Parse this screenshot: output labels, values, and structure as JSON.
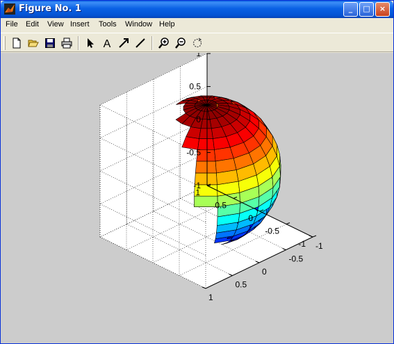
{
  "window": {
    "title": "Figure No. 1",
    "controls": {
      "minimize": "_",
      "maximize": "□",
      "close": "×"
    }
  },
  "menu": [
    "File",
    "Edit",
    "View",
    "Insert",
    "Tools",
    "Window",
    "Help"
  ],
  "toolbar": {
    "buttons": [
      {
        "icon": "new-file-icon"
      },
      {
        "icon": "open-folder-icon"
      },
      {
        "icon": "save-icon"
      },
      {
        "icon": "print-icon"
      },
      {
        "icon": "select-arrow-icon"
      },
      {
        "icon": "insert-text-icon",
        "glyph": "A"
      },
      {
        "icon": "insert-arrow-icon"
      },
      {
        "icon": "insert-line-icon"
      },
      {
        "icon": "zoom-in-icon"
      },
      {
        "icon": "zoom-out-icon"
      },
      {
        "icon": "rotate-3d-icon"
      }
    ]
  },
  "chart_data": {
    "type": "surface",
    "shape": "unit sphere",
    "colormap": "jet",
    "grid": true,
    "z_ticks": [
      "1",
      "0.5",
      "0",
      "-0.5",
      "-1"
    ],
    "y_ticks": [
      "1",
      "0.5",
      "0",
      "-0.5",
      "-1"
    ],
    "x_ticks": [
      "-1",
      "-0.5",
      "0",
      "0.5",
      "1"
    ],
    "xlim": [
      -1,
      1
    ],
    "ylim": [
      -1,
      1
    ],
    "zlim": [
      -1,
      1
    ]
  }
}
